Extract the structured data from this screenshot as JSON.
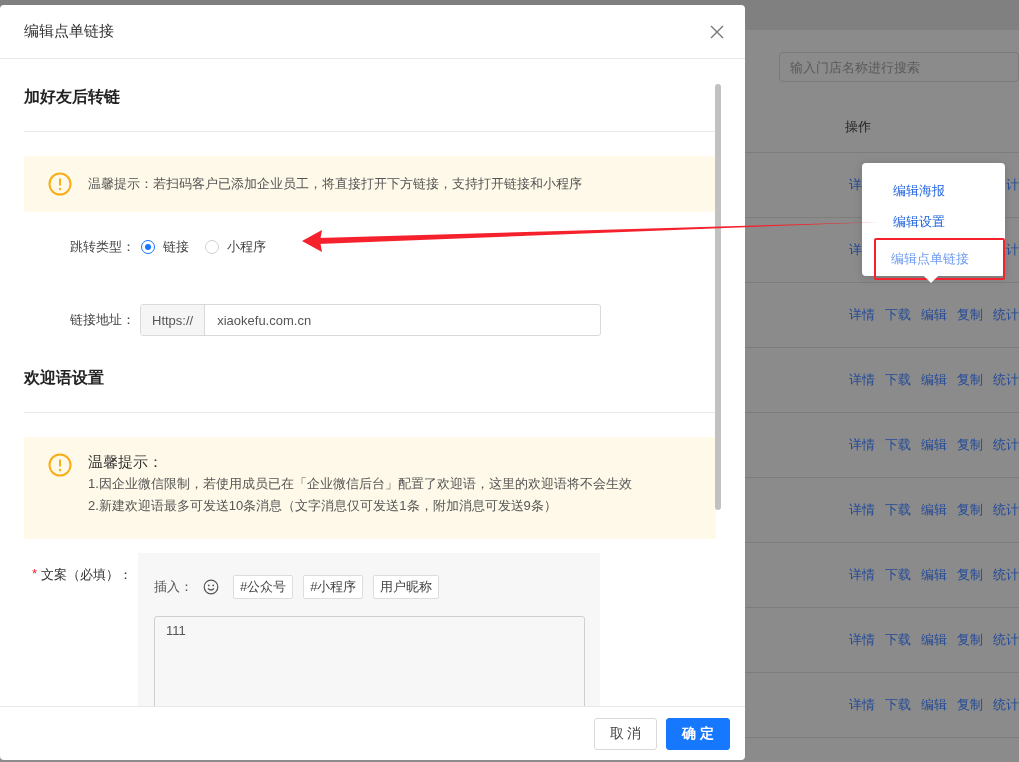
{
  "background_page": {
    "search": {
      "placeholder": "输入门店名称进行搜索"
    },
    "table": {
      "columns": [
        "操作"
      ],
      "rows": [
        {
          "kind": "covered",
          "left": "详",
          "right": "计"
        },
        {
          "kind": "covered",
          "left": "详",
          "right": "计"
        },
        {
          "kind": "full",
          "actions": [
            "详情",
            "下载",
            "编辑",
            "复制",
            "统计"
          ]
        },
        {
          "kind": "full",
          "actions": [
            "详情",
            "下载",
            "编辑",
            "复制",
            "统计"
          ]
        },
        {
          "kind": "full",
          "actions": [
            "详情",
            "下载",
            "编辑",
            "复制",
            "统计"
          ]
        },
        {
          "kind": "full",
          "actions": [
            "详情",
            "下载",
            "编辑",
            "复制",
            "统计"
          ]
        },
        {
          "kind": "full",
          "actions": [
            "详情",
            "下载",
            "编辑",
            "复制",
            "统计"
          ]
        },
        {
          "kind": "full",
          "actions": [
            "详情",
            "下载",
            "编辑",
            "复制",
            "统计"
          ]
        },
        {
          "kind": "full",
          "actions": [
            "详情",
            "下载",
            "编辑",
            "复制",
            "统计"
          ]
        }
      ]
    },
    "popover": {
      "items": [
        {
          "label": "编辑海报",
          "boxed": false
        },
        {
          "label": "编辑设置",
          "boxed": false
        },
        {
          "label": "编辑点单链接",
          "boxed": true
        }
      ]
    },
    "annotation_arrow": true
  },
  "dialog": {
    "title": "编辑点单链接",
    "sections": [
      {
        "title": "加好友后转链"
      },
      {
        "title": "欢迎语设置"
      }
    ],
    "tip1": {
      "text": "温馨提示：若扫码客户已添加企业员工，将直接打开下方链接，支持打开链接和小程序"
    },
    "jump_type": {
      "label": "跳转类型：",
      "options": [
        {
          "label": "链接",
          "selected": true
        },
        {
          "label": "小程序",
          "selected": false
        }
      ]
    },
    "link": {
      "label": "链接地址：",
      "prefix": "Https://",
      "value": "xiaokefu.com.cn"
    },
    "tip2": {
      "title": "温馨提示：",
      "lines": [
        "1.因企业微信限制，若使用成员已在「企业微信后台」配置了欢迎语，这里的欢迎语将不会生效",
        "2.新建欢迎语最多可发送10条消息（文字消息仅可发送1条，附加消息可发送9条）"
      ]
    },
    "copy": {
      "required_mark": "*",
      "label": "文案（必填）：",
      "insert_label": "插入：",
      "tags": [
        "#公众号",
        "#小程序",
        "用户昵称"
      ],
      "value": "111"
    },
    "buttons": {
      "cancel": "取 消",
      "ok": "确 定"
    }
  }
}
